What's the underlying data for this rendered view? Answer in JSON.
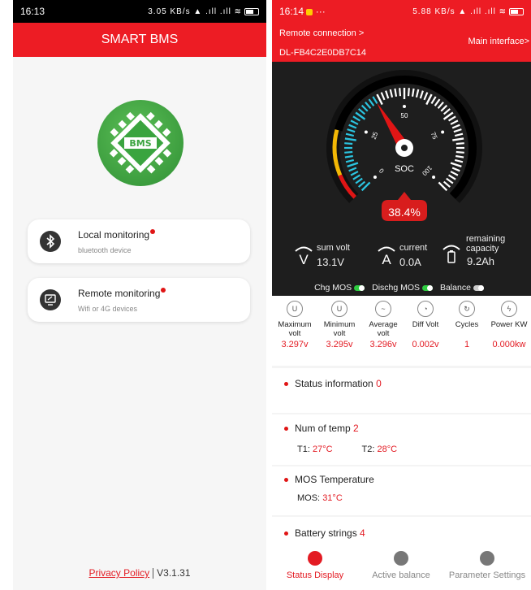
{
  "left": {
    "status_time": "16:13",
    "status_icons": "3.05 KB/s ▲ .ıll .ıll ≋",
    "app_title": "SMART BMS",
    "logo_text": "BMS",
    "local": {
      "title": "Local monitoring",
      "subtitle": "bluetooth device"
    },
    "remote": {
      "title": "Remote monitoring",
      "subtitle": "Wifi or 4G devices"
    },
    "privacy": "Privacy Policy",
    "version": "V3.1.31"
  },
  "right": {
    "status_time": "16:14",
    "status_extra": "···",
    "status_icons": "5.88 KB/s ▲ .ıll .ıll ≋",
    "remote_connection": "Remote connection >",
    "main_interface": "Main interface>",
    "device_id": "DL-FB4C2E0DB7C14",
    "gauge": {
      "soc_label": "SOC",
      "soc_value": "38.4%",
      "soc_fraction": 0.384,
      "ticks": [
        "0",
        "25",
        "50",
        "75",
        "100"
      ]
    },
    "sum_volt": {
      "label": "sum volt",
      "value": "13.1V"
    },
    "current": {
      "label": "current",
      "value": "0.0A"
    },
    "remaining": {
      "label1": "remaining",
      "label2": "capacity",
      "value": "9.2Ah"
    },
    "chg_mos": "Chg MOS",
    "dischg_mos": "Dischg MOS",
    "balance": "Balance",
    "metrics": [
      {
        "label": "Maximum volt",
        "value": "3.297v"
      },
      {
        "label": "Minimum volt",
        "value": "3.295v"
      },
      {
        "label": "Average volt",
        "value": "3.296v"
      },
      {
        "label": "Diff Volt",
        "value": "0.002v"
      },
      {
        "label": "Cycles",
        "value": "1"
      },
      {
        "label": "Power KW",
        "value": "0.000kw"
      }
    ],
    "status_info": {
      "label": "Status information",
      "value": "0"
    },
    "num_temp": {
      "label": "Num of temp",
      "value": "2",
      "t1_label": "T1:",
      "t1": "27°C",
      "t2_label": "T2:",
      "t2": "28°C"
    },
    "mos_temp": {
      "label": "MOS Temperature",
      "mos_label": "MOS:",
      "mos": "31°C"
    },
    "battery_strings": {
      "label": "Battery strings",
      "value": "4"
    },
    "tabs": [
      "Status Display",
      "Active balance",
      "Parameter Settings"
    ],
    "colors": {
      "accent": "#ed1c24",
      "toggle_on": "#2ecc40",
      "toggle_off": "#cccccc"
    }
  }
}
